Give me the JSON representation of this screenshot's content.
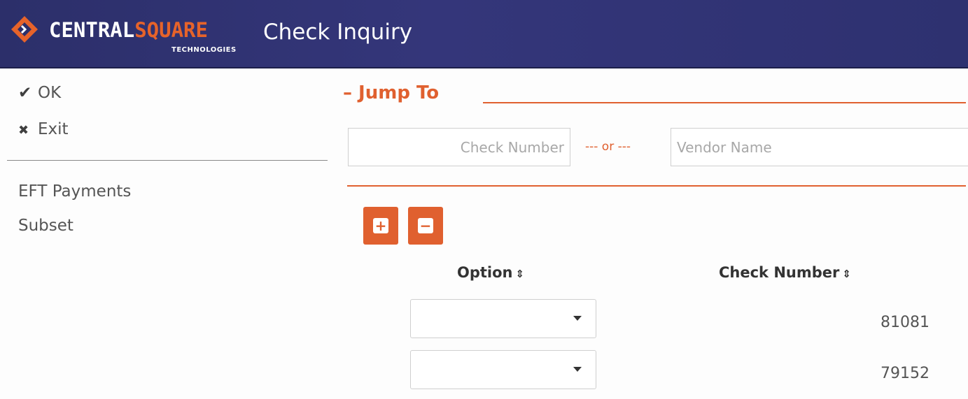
{
  "header": {
    "brand_part1": "CENTRAL",
    "brand_part2": "SQUARE",
    "brand_sub": "TECHNOLOGIES",
    "title": "Check Inquiry",
    "logo_icon": "centralsquare-logo-icon"
  },
  "sidebar": {
    "ok": {
      "icon": "✔",
      "label": "OK"
    },
    "exit": {
      "icon": "✖",
      "label": "Exit"
    },
    "links": [
      {
        "label": "EFT Payments"
      },
      {
        "label": "Subset"
      }
    ]
  },
  "jump_to": {
    "title": "– Jump To",
    "check_number_placeholder": "Check Number",
    "or_label": "--- or ---",
    "vendor_name_placeholder": "Vendor Name"
  },
  "actions": {
    "add_icon": "+",
    "remove_icon": "−"
  },
  "table": {
    "columns": [
      "Option",
      "Check Number"
    ],
    "sort_icon": "⇕",
    "rows": [
      {
        "option": "",
        "check_number": "81081"
      },
      {
        "option": "",
        "check_number": "79152"
      }
    ]
  },
  "colors": {
    "header_bg": "#2c2f6a",
    "accent": "#e0602f"
  }
}
